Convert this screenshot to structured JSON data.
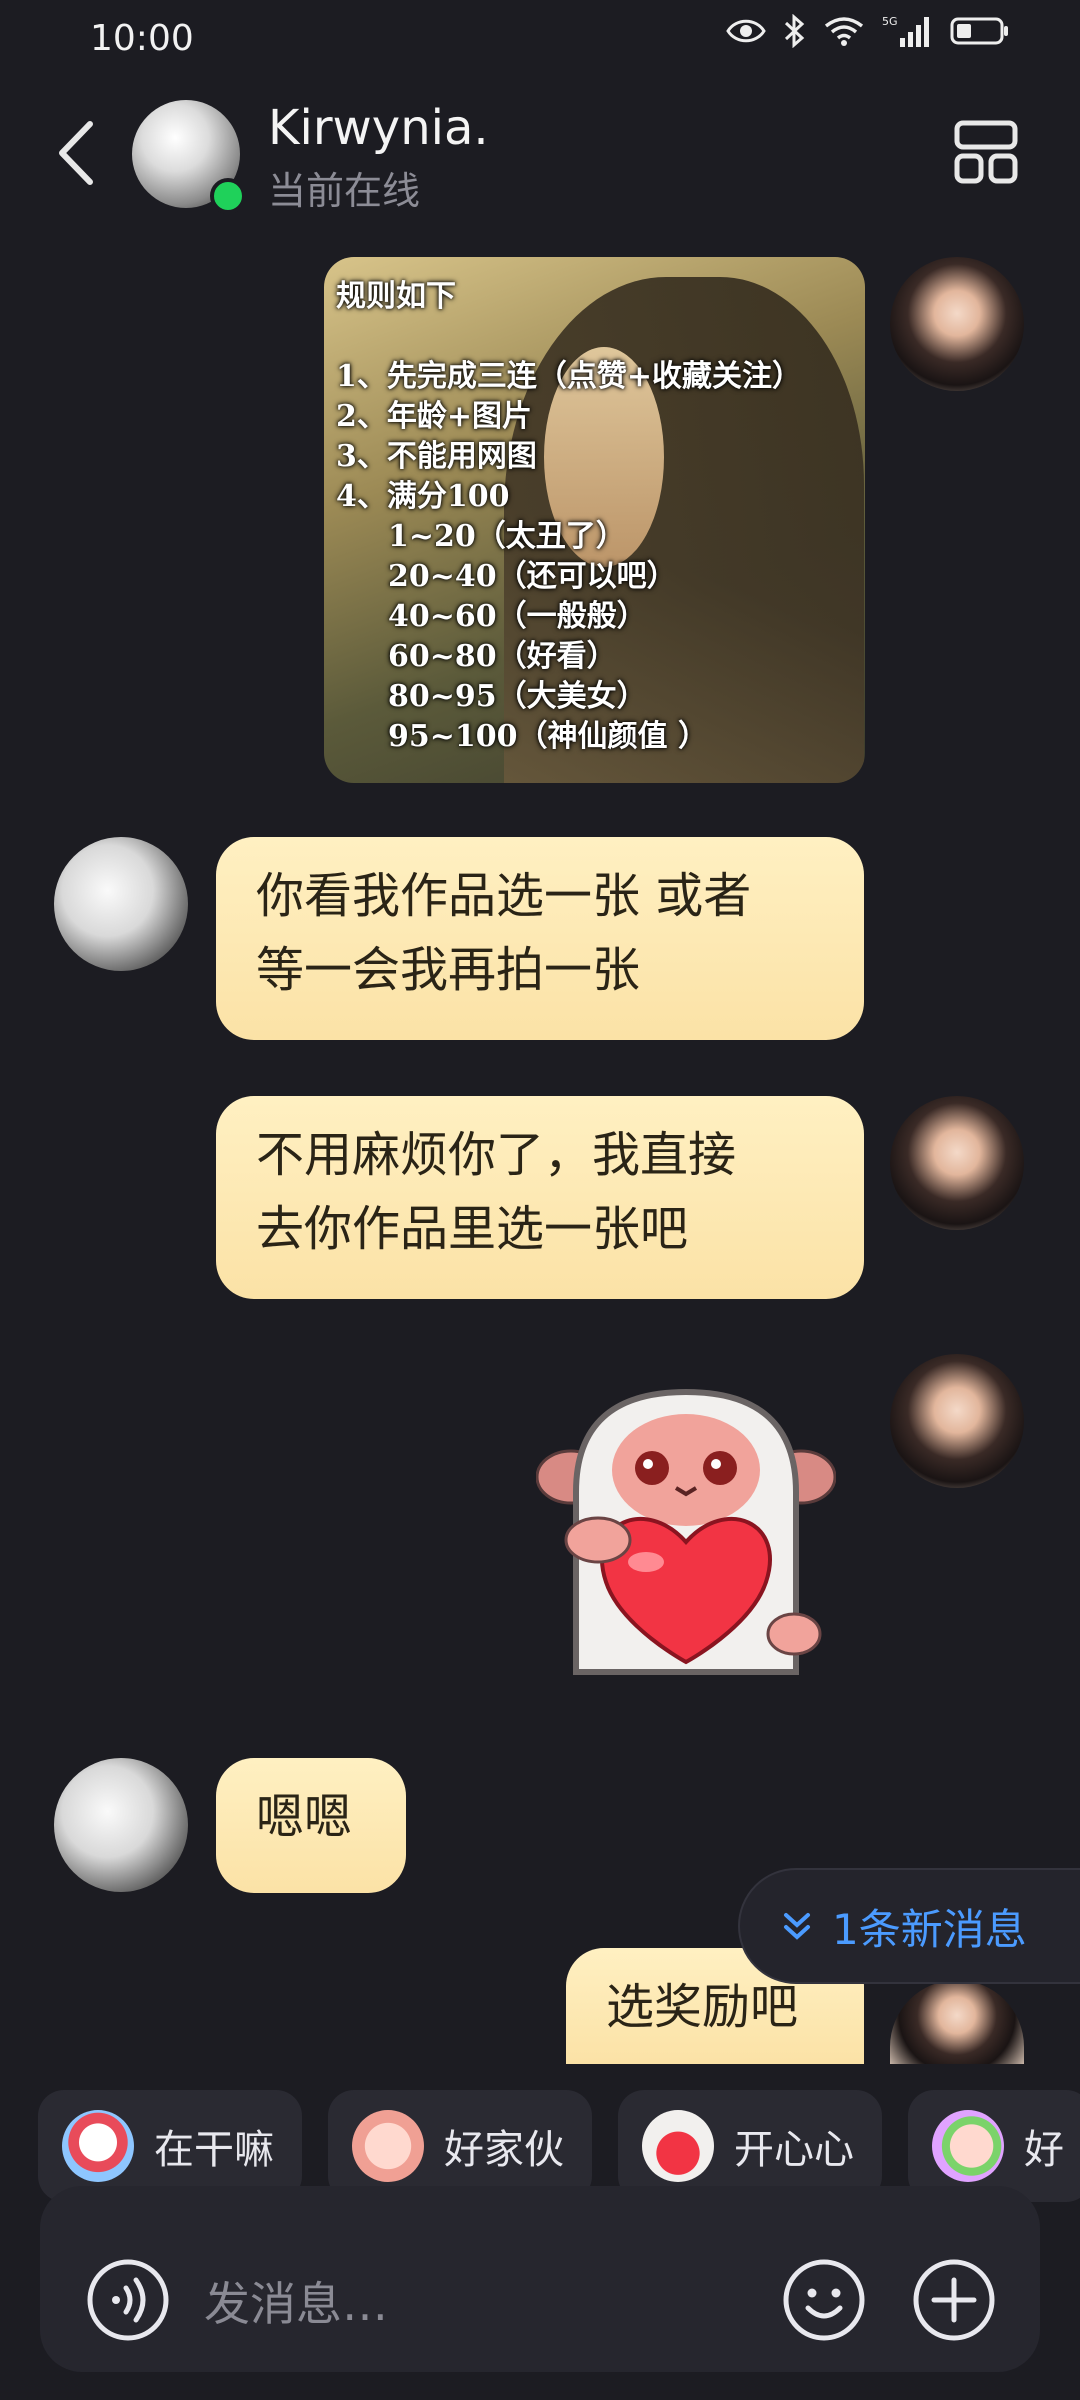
{
  "status_bar": {
    "time": "10:00",
    "network": "5G"
  },
  "header": {
    "name": "Kirwynia.",
    "status": "当前在线"
  },
  "photo_message": {
    "rules": [
      "规则如下",
      "",
      "1、先完成三连（点赞+收藏关注）",
      "2、年龄+图片",
      "3、不能用网图",
      "4、满分100"
    ],
    "score_ranges": [
      "1~20（太丑了）",
      "20~40（还可以吧）",
      "40~60（一般般）",
      "60~80（好看）",
      "80~95（大美女）",
      "95~100（神仙颜值 ）"
    ]
  },
  "messages": [
    {
      "side": "left",
      "text": "你看我作品选一张 或者\n等一会我再拍一张"
    },
    {
      "side": "right",
      "text": "不用麻烦你了，我直接\n去你作品里选一张吧"
    },
    {
      "side": "left",
      "text": "嗯嗯"
    },
    {
      "side": "right",
      "text": "选奖励吧"
    }
  ],
  "new_messages_pill": "1条新消息",
  "quick_replies": [
    "在干嘛",
    "好家伙",
    "开心心",
    "好"
  ],
  "input": {
    "placeholder": "发消息…"
  },
  "colors": {
    "accent": "#4b9bff",
    "bubble": "#fbe2a6",
    "online": "#1fd15a",
    "background": "#1c1c22"
  }
}
